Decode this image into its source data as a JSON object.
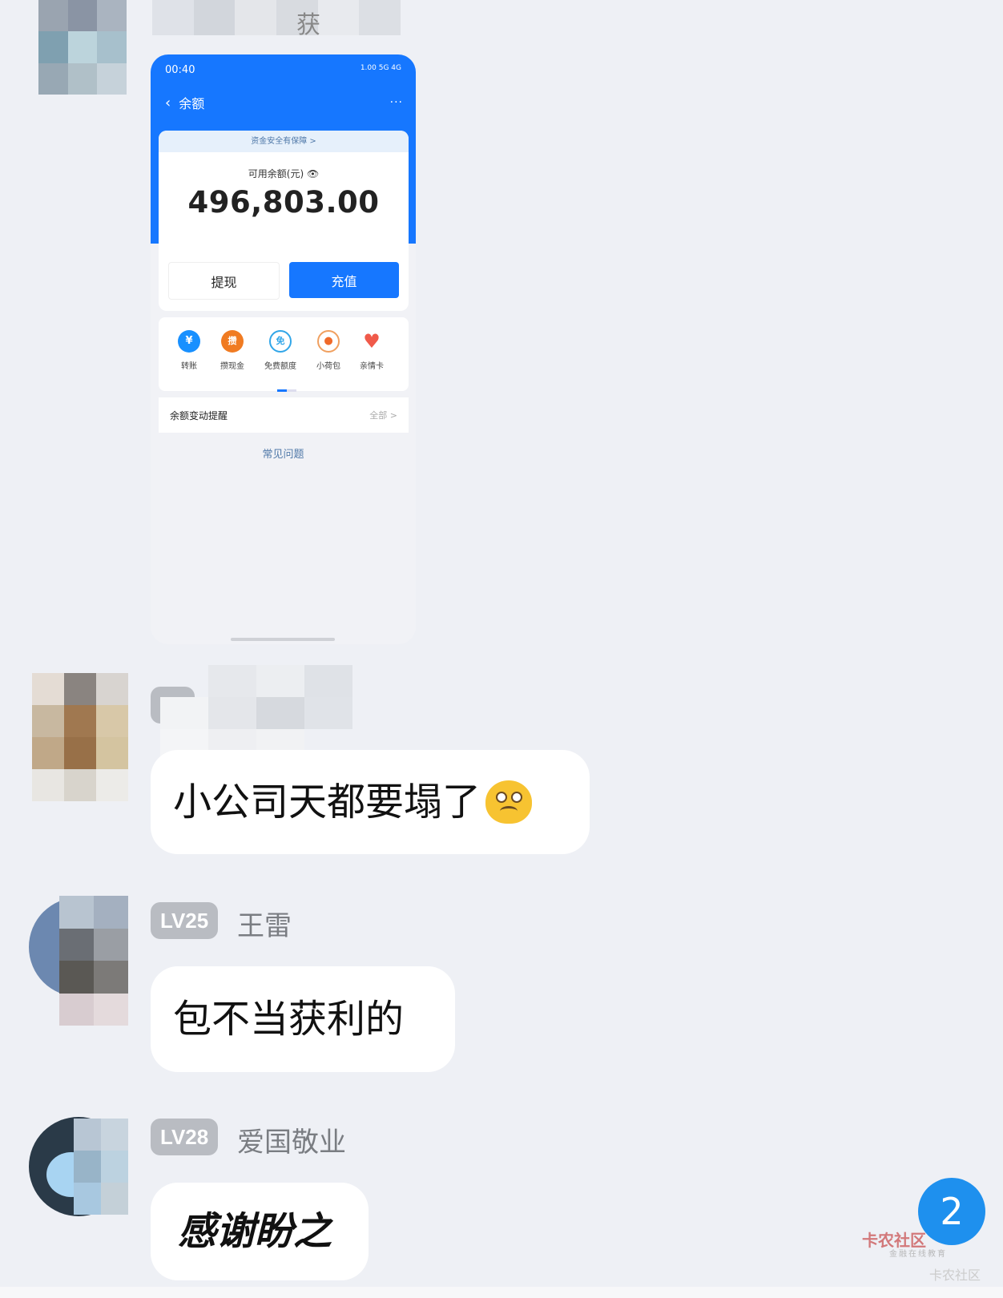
{
  "colors": {
    "primary": "#1677ff",
    "bubble": "#ffffff",
    "level_badge": "#b9bcc2",
    "unread_badge": "#1e90ee"
  },
  "top_name_fragment": "获",
  "shared_screenshot": {
    "status_time": "00:40",
    "status_right": "1.00 5G 4G",
    "nav_back_icon": "chevron-left-icon",
    "nav_title": "余额",
    "nav_more": "···",
    "safety_text": "资金安全有保障 >",
    "balance_label": "可用余额(元)",
    "balance_value": "496,803.00",
    "withdraw_label": "提现",
    "recharge_label": "充值",
    "quick_actions": [
      {
        "label": "转账",
        "glyph": "¥",
        "color": "#1890ff"
      },
      {
        "label": "攒现金",
        "glyph": "攒",
        "color": "#f07b22"
      },
      {
        "label": "免费额度",
        "glyph": "免",
        "color": "#31a6e8"
      },
      {
        "label": "小荷包",
        "glyph": "●",
        "color": "#f06a2a"
      },
      {
        "label": "亲情卡",
        "glyph": "♥",
        "color": "#f05a4a"
      }
    ],
    "balance_change_title": "余额变动提醒",
    "balance_change_all": "全部 >",
    "faq": "常见问题"
  },
  "messages": [
    {
      "level": "LV",
      "name": "",
      "text": "小公司天都要塌了",
      "emoji": "frown-emoji"
    },
    {
      "level": "LV25",
      "name": "王雷",
      "text": "包不当获利的"
    },
    {
      "level": "LV28",
      "name": "爱国敬业",
      "text": "感谢盼之"
    }
  ],
  "unread_badge": "2",
  "watermark": {
    "logo": "卡农社区",
    "sub": "金融在线教育",
    "bottom": "卡农社区"
  }
}
